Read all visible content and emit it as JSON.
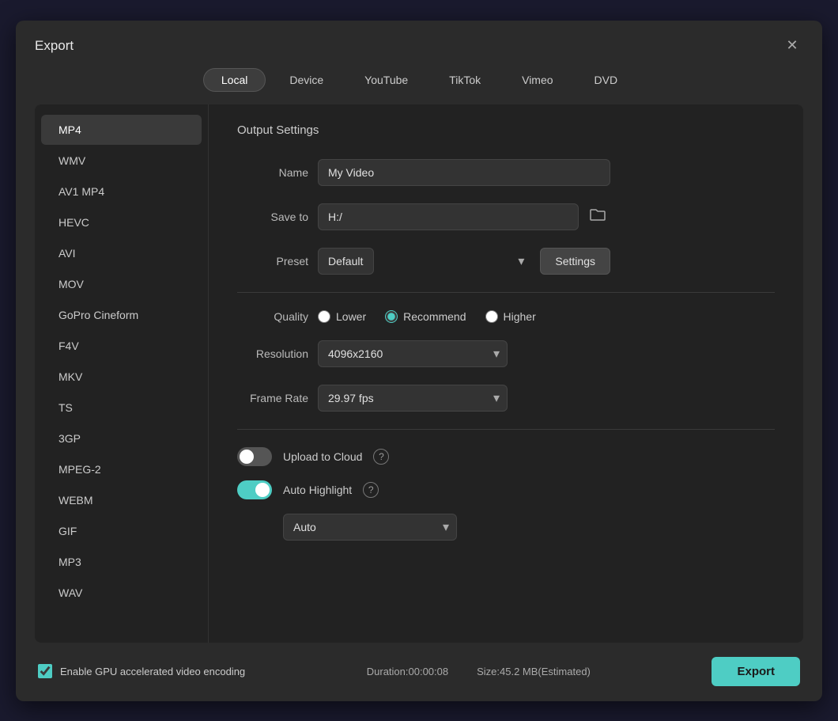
{
  "dialog": {
    "title": "Export",
    "close_label": "✕"
  },
  "tabs": [
    {
      "id": "local",
      "label": "Local",
      "active": true
    },
    {
      "id": "device",
      "label": "Device",
      "active": false
    },
    {
      "id": "youtube",
      "label": "YouTube",
      "active": false
    },
    {
      "id": "tiktok",
      "label": "TikTok",
      "active": false
    },
    {
      "id": "vimeo",
      "label": "Vimeo",
      "active": false
    },
    {
      "id": "dvd",
      "label": "DVD",
      "active": false
    }
  ],
  "formats": [
    {
      "id": "mp4",
      "label": "MP4",
      "active": true
    },
    {
      "id": "wmv",
      "label": "WMV",
      "active": false
    },
    {
      "id": "av1mp4",
      "label": "AV1 MP4",
      "active": false
    },
    {
      "id": "hevc",
      "label": "HEVC",
      "active": false
    },
    {
      "id": "avi",
      "label": "AVI",
      "active": false
    },
    {
      "id": "mov",
      "label": "MOV",
      "active": false
    },
    {
      "id": "gopro",
      "label": "GoPro Cineform",
      "active": false
    },
    {
      "id": "f4v",
      "label": "F4V",
      "active": false
    },
    {
      "id": "mkv",
      "label": "MKV",
      "active": false
    },
    {
      "id": "ts",
      "label": "TS",
      "active": false
    },
    {
      "id": "3gp",
      "label": "3GP",
      "active": false
    },
    {
      "id": "mpeg2",
      "label": "MPEG-2",
      "active": false
    },
    {
      "id": "webm",
      "label": "WEBM",
      "active": false
    },
    {
      "id": "gif",
      "label": "GIF",
      "active": false
    },
    {
      "id": "mp3",
      "label": "MP3",
      "active": false
    },
    {
      "id": "wav",
      "label": "WAV",
      "active": false
    }
  ],
  "output": {
    "section_title": "Output Settings",
    "name_label": "Name",
    "name_value": "My Video",
    "save_to_label": "Save to",
    "save_to_value": "H:/",
    "preset_label": "Preset",
    "preset_value": "Default",
    "settings_btn": "Settings",
    "quality_label": "Quality",
    "quality_lower": "Lower",
    "quality_recommend": "Recommend",
    "quality_higher": "Higher",
    "resolution_label": "Resolution",
    "resolution_value": "4096x2160",
    "frame_rate_label": "Frame Rate",
    "frame_rate_value": "29.97 fps",
    "upload_cloud_label": "Upload to Cloud",
    "auto_highlight_label": "Auto Highlight",
    "auto_dropdown_value": "Auto"
  },
  "footer": {
    "gpu_label": "Enable GPU accelerated video encoding",
    "duration_label": "Duration:00:00:08",
    "size_label": "Size:45.2 MB(Estimated)",
    "export_btn": "Export"
  }
}
